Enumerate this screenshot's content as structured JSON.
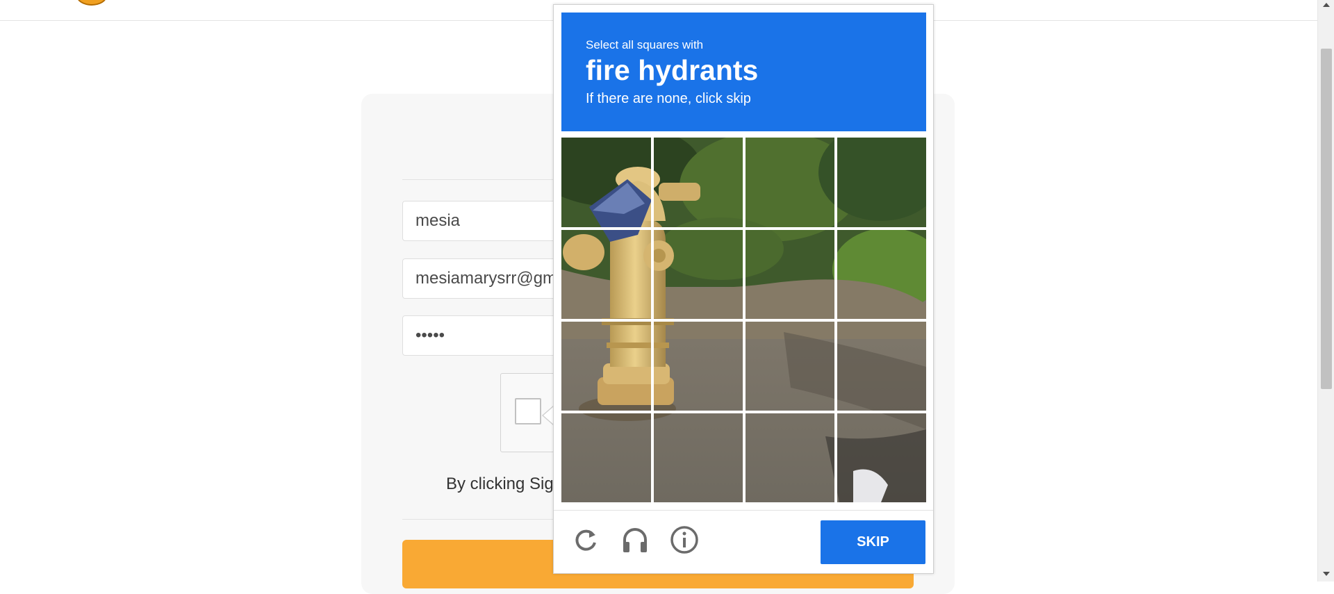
{
  "form": {
    "name_value": "mesia",
    "email_value": "mesiamarysrr@gmail.com",
    "password_value": "•••••",
    "terms_text": "By clicking Sign Up, you agree to our Terms and Privacy Policy."
  },
  "challenge": {
    "instruction_pre": "Select all squares with",
    "target": "fire hydrants",
    "instruction_sub": "If there are none, click skip",
    "grid_rows": 4,
    "grid_cols": 4,
    "skip_label": "SKIP",
    "footer_icons": [
      "reload-icon",
      "audio-headphones-icon",
      "info-icon"
    ]
  },
  "colors": {
    "captcha_blue": "#1a73e8",
    "signup_orange": "#f9a934"
  }
}
